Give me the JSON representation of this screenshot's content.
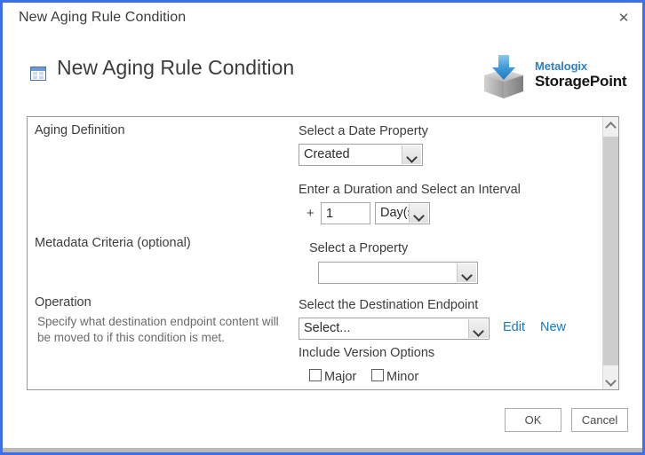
{
  "window": {
    "title": "New Aging Rule Condition",
    "close_label": "✕",
    "accent_border": "#3f6fe8"
  },
  "header": {
    "title": "New Aging Rule Condition",
    "icon": "table-icon",
    "logo": {
      "brand_top": "Metalogix",
      "brand_bottom": "StoragePoint",
      "brand_top_color": "#2f7fc4",
      "arrow_color": "#3f9bdc"
    }
  },
  "form": {
    "sections": {
      "aging": {
        "label": "Aging Definition",
        "date_property_label": "Select a Date Property",
        "date_property_value": "Created",
        "duration_label": "Enter a Duration and Select an Interval",
        "duration_prefix": "+",
        "duration_value": "1",
        "interval_value": "Day(s)"
      },
      "metadata": {
        "label": "Metadata Criteria (optional)",
        "property_label": "Select a Property",
        "property_value": ""
      },
      "operation": {
        "label": "Operation",
        "description": "Specify what destination endpoint content will be moved to if this condition is met.",
        "endpoint_label": "Select the Destination Endpoint",
        "endpoint_value": "Select...",
        "edit_link": "Edit",
        "new_link": "New",
        "version_options_label": "Include Version Options",
        "major_label": "Major",
        "minor_label": "Minor",
        "major_checked": false,
        "minor_checked": false,
        "link_color": "#1379c6"
      }
    }
  },
  "footer": {
    "ok_label": "OK",
    "cancel_label": "Cancel"
  },
  "scrollbar": {
    "up_arrow": "scroll-up",
    "down_arrow": "scroll-down"
  }
}
